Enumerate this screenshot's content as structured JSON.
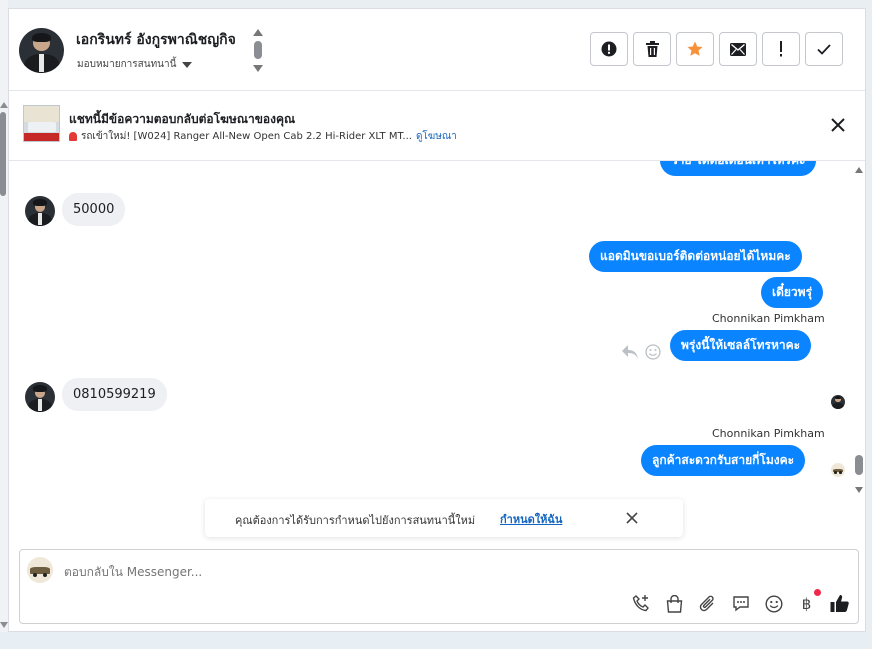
{
  "header": {
    "contact_name": "เอกรินทร์ อังกูรพาณิชญกิจ",
    "assign_label": "มอบหมายการสนทนานี้",
    "toolbar": [
      {
        "name": "spam-report-button",
        "icon": "alert-circle-icon"
      },
      {
        "name": "delete-button",
        "icon": "trash-icon"
      },
      {
        "name": "star-button",
        "icon": "star-icon",
        "color": "#f7923b"
      },
      {
        "name": "mark-unread-button",
        "icon": "envelope-icon"
      },
      {
        "name": "follow-up-button",
        "icon": "exclamation-icon"
      },
      {
        "name": "mark-done-button",
        "icon": "check-icon"
      }
    ]
  },
  "ad": {
    "title": "แชทนี้มีข้อความตอบกลับต่อโฆษณาของคุณ",
    "subtitle": "รถเข้าใหม่! [W024] Ranger All-New Open Cab 2.2 Hi-Rider XLT MT...",
    "link": "ดูโฆษณา"
  },
  "messages": {
    "partial_top": "ว่าย ได้ต่อเดือนเท่าไหร่คะ",
    "incoming_1": "50000",
    "out_1": "แอดมินขอเบอร์ติดต่อหน่อยได้ไหมคะ",
    "out_2": "เดี๋ยวพรุ่",
    "sender_1": "Chonnikan Pimkham",
    "out_3": "พรุ่งนี้ให้เซลล์โทรหาคะ",
    "incoming_2": "0810599219",
    "sender_2": "Chonnikan Pimkham",
    "out_4": "ลูกค้าสะดวกรับสายกี่โมงคะ"
  },
  "prompt": {
    "text": "คุณต้องการได้รับการกำหนดไปยังการสนทนานี้ใหม่",
    "link": "กำหนดให้ฉัน"
  },
  "composer": {
    "placeholder": "ตอบกลับใน Messenger...",
    "tools": [
      "call-icon",
      "shopping-bag-icon",
      "paperclip-icon",
      "saved-reply-icon",
      "emoji-icon",
      "baht-icon",
      "like-icon"
    ],
    "accent": "#0a84ff"
  }
}
